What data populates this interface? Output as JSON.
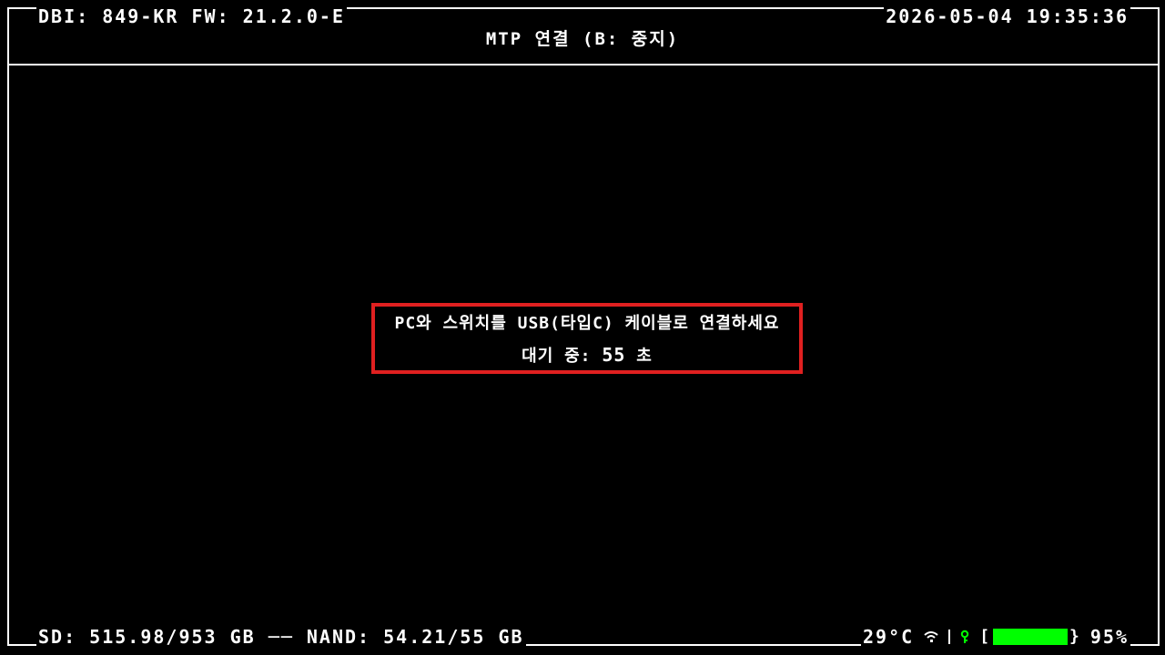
{
  "header": {
    "dbi_text": "DBI: 849-KR",
    "fw_text": "FW: 21.2.0-E",
    "datetime": "2026-05-04 19:35:36",
    "title": "MTP 연결 (B: 중지)"
  },
  "message": {
    "instruction": "PC와 스위치를 USB(타입C) 케이블로 연결하세요",
    "countdown_label": "대기 중:",
    "countdown_value": "55",
    "countdown_unit": "초"
  },
  "footer": {
    "sd_text": "SD: 515.98/953 GB",
    "nand_text": "NAND: 54.21/55 GB",
    "temperature": "29°C",
    "battery_percent": "95%",
    "battery_level": 0.95
  },
  "icons": {
    "wifi": "wifi-icon",
    "charging": "charging-icon",
    "battery": "battery-icon"
  },
  "colors": {
    "background": "#000000",
    "foreground": "#ffffff",
    "message_border": "#e02020",
    "battery_fill": "#00ff00",
    "charging": "#00ff00"
  }
}
